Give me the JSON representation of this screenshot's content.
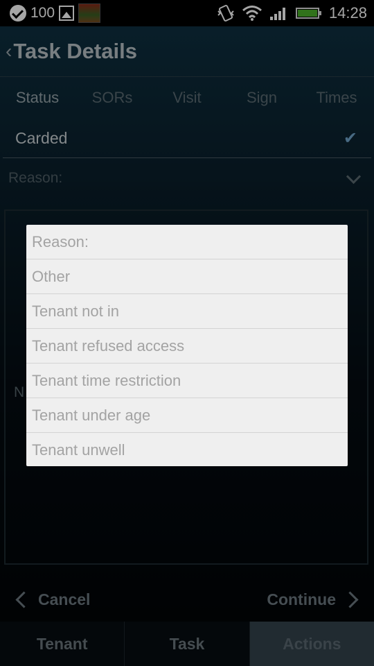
{
  "status_bar": {
    "battery_text": "100",
    "clock": "14:28",
    "icons": [
      "check-circle-icon",
      "image-icon",
      "app-thumbnail-icon",
      "vibrate-icon",
      "wifi-icon",
      "signal-icon",
      "battery-icon"
    ]
  },
  "header": {
    "title": "Task Details"
  },
  "tabs": [
    "Status",
    "SORs",
    "Visit",
    "Sign",
    "Times"
  ],
  "status": {
    "carded_label": "Carded",
    "reason_label": "Reason:",
    "notes_label_partial": "N"
  },
  "actions": {
    "cancel_label": "Cancel",
    "continue_label": "Continue"
  },
  "nav": [
    "Tenant",
    "Task",
    "Actions"
  ],
  "dialog": {
    "items": [
      "Reason:",
      "Other",
      "Tenant not in",
      "Tenant refused access",
      "Tenant time restriction",
      "Tenant under age",
      "Tenant unwell"
    ]
  },
  "colors": {
    "accent_check": "#6fa3c9",
    "battery_green": "#4caf2a",
    "dialog_bg": "#efefef"
  }
}
